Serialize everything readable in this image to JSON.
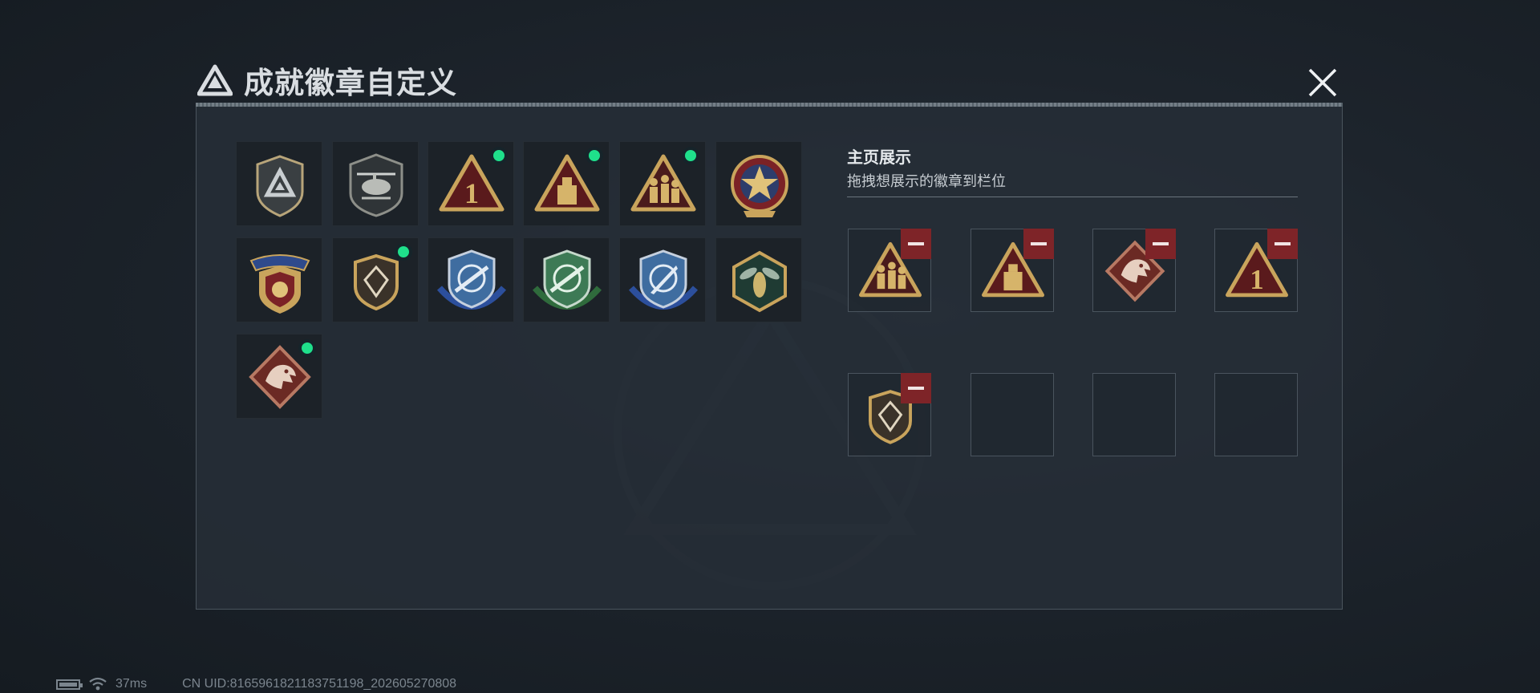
{
  "dialog": {
    "title": "成就徽章自定义",
    "title_icon": "triangle-logo-icon",
    "close_icon": "close-icon"
  },
  "badge_collection": [
    {
      "name": "triangle-shield-badge",
      "new": false
    },
    {
      "name": "helicopter-badge",
      "new": false
    },
    {
      "name": "number-one-triangle-badge",
      "new": true
    },
    {
      "name": "tower-triangle-badge",
      "new": true
    },
    {
      "name": "soldiers-triangle-badge",
      "new": true
    },
    {
      "name": "star-medal-badge",
      "new": false
    },
    {
      "name": "winged-medal-badge",
      "new": false
    },
    {
      "name": "diamond-shield-badge",
      "new": true
    },
    {
      "name": "blue-rifle-scope-badge",
      "new": false
    },
    {
      "name": "green-rifle-scope-badge",
      "new": false
    },
    {
      "name": "blue-knife-scope-badge",
      "new": false
    },
    {
      "name": "hornet-hexagon-badge",
      "new": false
    },
    {
      "name": "dragon-diamond-badge",
      "new": true
    }
  ],
  "homepage_display": {
    "title": "主页展示",
    "subtitle": "拖拽想展示的徽章到栏位",
    "slots": [
      {
        "badge": "soldiers-triangle-badge",
        "removable": true
      },
      {
        "badge": "tower-triangle-badge",
        "removable": true
      },
      {
        "badge": "dragon-diamond-badge",
        "removable": true
      },
      {
        "badge": "number-one-triangle-badge",
        "removable": true
      },
      {
        "badge": "diamond-shield-badge",
        "removable": true
      },
      {
        "badge": "",
        "removable": false
      },
      {
        "badge": "",
        "removable": false
      },
      {
        "badge": "",
        "removable": false
      }
    ]
  },
  "status_bar": {
    "ping": "37ms",
    "uid": "CN UID:8165961821183751198_202605270808"
  },
  "colors": {
    "gold": "#c9a45c",
    "dark_red": "#5a1a1c",
    "remove_red": "#7e2428",
    "new_dot_green": "#1fe08b"
  }
}
